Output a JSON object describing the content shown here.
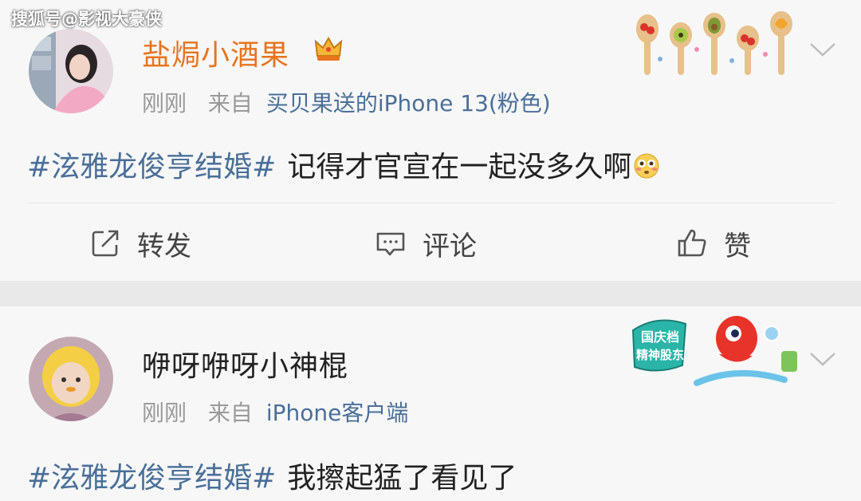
{
  "watermark": "搜狐号@影视大豪侠",
  "posts": [
    {
      "username": "盐焗小酒果",
      "time": "刚刚",
      "from_label": "来自",
      "source": "买贝果送的iPhone 13(粉色)",
      "hashtag": "#泫雅龙俊亨结婚#",
      "text": "记得才官宣在一起没多久啊",
      "emoji": "flushed-face",
      "has_vip_crown": true
    },
    {
      "username": "咿呀咿呀小神棍",
      "time": "刚刚",
      "from_label": "来自",
      "source": "iPhone客户端",
      "hashtag": "#泫雅龙俊亨结婚#",
      "text": "我擦起猛了看见了",
      "deco_text": [
        "国庆档",
        "精神股东"
      ]
    }
  ],
  "actions": {
    "repost": "转发",
    "comment": "评论",
    "like": "赞"
  },
  "colors": {
    "accent_link": "#4a6f99",
    "vip_name": "#e8741d",
    "meta_gray": "#999999",
    "background": "#f7f7f7"
  }
}
